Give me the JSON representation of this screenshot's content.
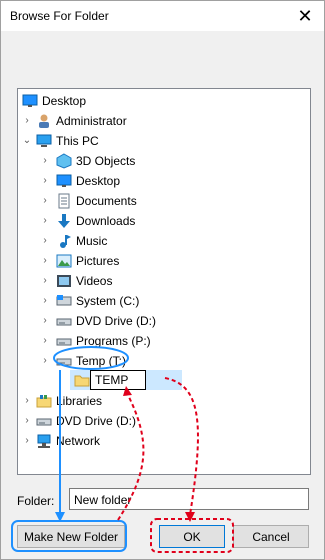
{
  "dialog": {
    "title": "Browse For Folder",
    "close_icon": "close-icon"
  },
  "tree": {
    "items": [
      {
        "label": "Desktop",
        "icon": "desktop-icon"
      },
      {
        "label": "Administrator",
        "icon": "user-icon"
      },
      {
        "label": "This PC",
        "icon": "computer-icon"
      },
      {
        "label": "3D Objects",
        "icon": "3d-objects-icon"
      },
      {
        "label": "Desktop",
        "icon": "desktop-icon"
      },
      {
        "label": "Documents",
        "icon": "documents-icon"
      },
      {
        "label": "Downloads",
        "icon": "downloads-icon"
      },
      {
        "label": "Music",
        "icon": "music-icon"
      },
      {
        "label": "Pictures",
        "icon": "pictures-icon"
      },
      {
        "label": "Videos",
        "icon": "videos-icon"
      },
      {
        "label": "System (C:)",
        "icon": "drive-icon"
      },
      {
        "label": "DVD Drive (D:)",
        "icon": "dvd-icon"
      },
      {
        "label": "Programs (P:)",
        "icon": "drive-icon"
      },
      {
        "label": "Temp (T:)",
        "icon": "drive-icon"
      },
      {
        "label": "TEMP",
        "icon": "folder-icon"
      },
      {
        "label": "Libraries",
        "icon": "libraries-icon"
      },
      {
        "label": "DVD Drive (D:)",
        "icon": "dvd-icon"
      },
      {
        "label": "Network",
        "icon": "network-icon"
      }
    ]
  },
  "folder": {
    "label": "Folder:",
    "value": "New folder"
  },
  "buttons": {
    "new_folder": "Make New Folder",
    "ok": "OK",
    "cancel": "Cancel"
  },
  "colors": {
    "annotation_blue": "#1e90ff",
    "annotation_red": "#e0001b",
    "selection": "#cce8ff"
  }
}
